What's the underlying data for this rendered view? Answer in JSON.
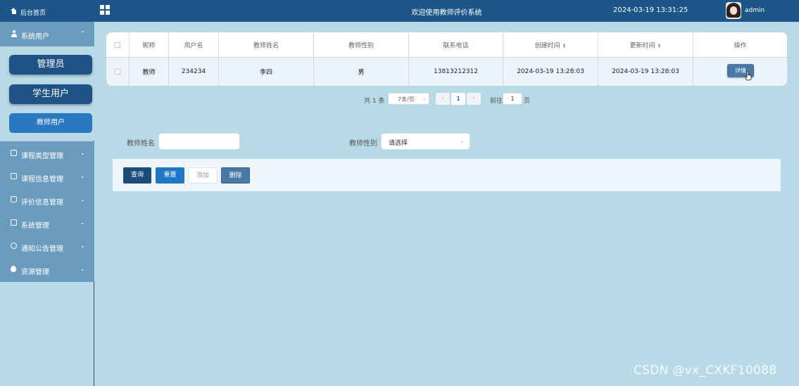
{
  "header": {
    "system_title": "欢迎使用教师评价系统",
    "datetime": "2024-03-19 13:31:25",
    "username": "admin"
  },
  "sidebar": {
    "home_label": "后台首页",
    "system_user_label": "系统用户",
    "sub_items": [
      "管理员",
      "学生用户",
      "教师用户"
    ],
    "menu_items": [
      {
        "label": "课程类型管理",
        "icon": "edit-square-icon"
      },
      {
        "label": "课程信息管理",
        "icon": "edit-square-icon"
      },
      {
        "label": "评价信息管理",
        "icon": "edit-square-icon"
      },
      {
        "label": "系统管理",
        "icon": "image-icon"
      },
      {
        "label": "通知公告管理",
        "icon": "info-circle-icon"
      },
      {
        "label": "资源管理",
        "icon": "bulb-icon"
      }
    ]
  },
  "table": {
    "columns": [
      "昵称",
      "用户名",
      "教师姓名",
      "教师性别",
      "联系电话",
      "创建时间",
      "更新时间",
      "操作"
    ],
    "rows": [
      {
        "nickname": "教师",
        "username": "234234",
        "teacher_name": "李四",
        "gender": "男",
        "phone": "13813212312",
        "created": "2024-03-19 13:28:03",
        "updated": "2024-03-19 13:28:03",
        "action": "详情"
      }
    ]
  },
  "pagination": {
    "total_text": "共 1 条",
    "page_size": "7条/页",
    "current_page": "1",
    "goto_label": "前往",
    "goto_value": "1",
    "page_suffix": "页"
  },
  "search": {
    "name_label": "教师姓名",
    "name_value": "",
    "gender_label": "教师性别",
    "gender_placeholder": "请选择"
  },
  "actions": {
    "query": "查询",
    "reset": "重置",
    "add": "添加",
    "delete": "删除"
  },
  "watermark": "CSDN @vx_CXKF10088"
}
